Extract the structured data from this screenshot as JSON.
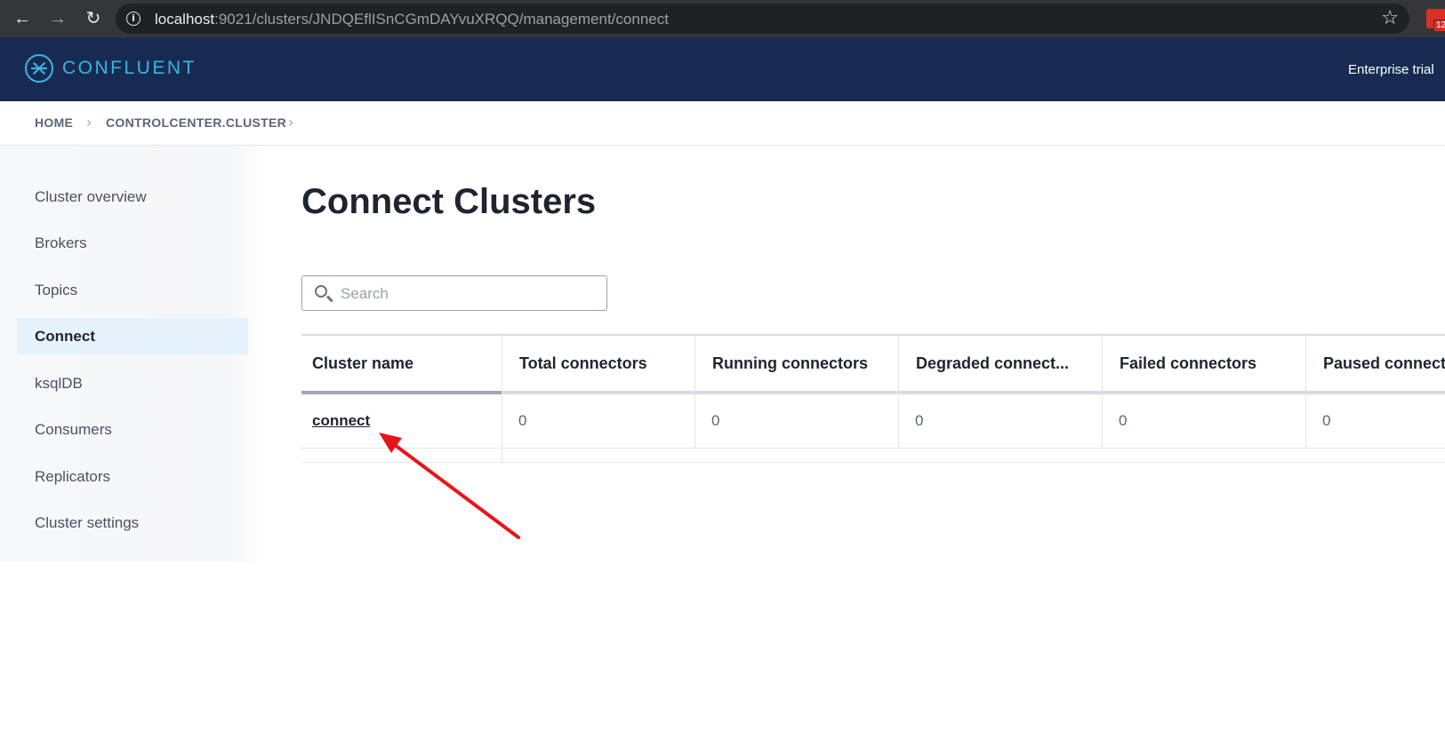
{
  "browser": {
    "url_host": "localhost",
    "url_rest": ":9021/clusters/JNDQEflISnCGmDAYvuXRQQ/management/connect",
    "extension_badge": "12"
  },
  "header": {
    "logo_text": "CONFLUENT",
    "trial_text": "Enterprise trial"
  },
  "breadcrumb": {
    "home": "HOME",
    "cluster": "CONTROLCENTER.CLUSTER"
  },
  "sidebar": {
    "items": [
      {
        "label": "Cluster overview"
      },
      {
        "label": "Brokers"
      },
      {
        "label": "Topics"
      },
      {
        "label": "Connect"
      },
      {
        "label": "ksqlDB"
      },
      {
        "label": "Consumers"
      },
      {
        "label": "Replicators"
      },
      {
        "label": "Cluster settings"
      }
    ],
    "active": "Connect"
  },
  "main": {
    "title": "Connect Clusters",
    "search": {
      "placeholder": "Search",
      "value": ""
    },
    "table": {
      "columns": [
        "Cluster name",
        "Total connectors",
        "Running connectors",
        "Degraded connect...",
        "Failed connectors",
        "Paused connect"
      ],
      "rows": [
        [
          "connect",
          "0",
          "0",
          "0",
          "0",
          "0"
        ]
      ]
    }
  },
  "annotation": {
    "arrow_color": "#e8141b"
  }
}
